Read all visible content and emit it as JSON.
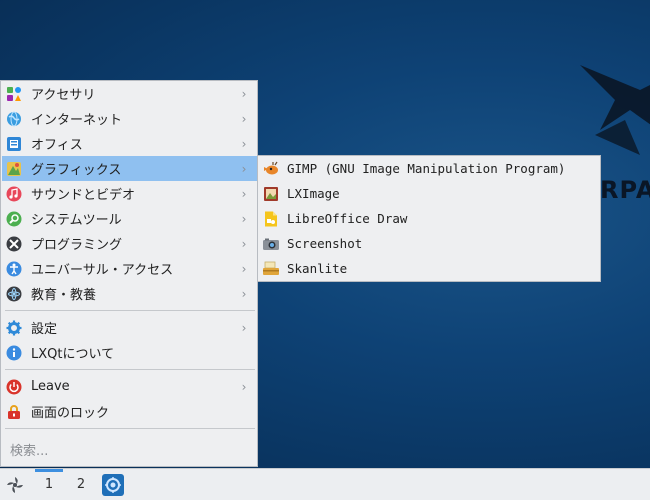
{
  "menu": {
    "items": [
      {
        "label": "アクセサリ",
        "icon": "accessories-icon",
        "has_submenu": true
      },
      {
        "label": "インターネット",
        "icon": "internet-icon",
        "has_submenu": true
      },
      {
        "label": "オフィス",
        "icon": "office-icon",
        "has_submenu": true
      },
      {
        "label": "グラフィックス",
        "icon": "graphics-icon",
        "has_submenu": true,
        "active": true
      },
      {
        "label": "サウンドとビデオ",
        "icon": "sound-video-icon",
        "has_submenu": true
      },
      {
        "label": "システムツール",
        "icon": "system-tools-icon",
        "has_submenu": true
      },
      {
        "label": "プログラミング",
        "icon": "programming-icon",
        "has_submenu": true
      },
      {
        "label": "ユニバーサル・アクセス",
        "icon": "universal-access-icon",
        "has_submenu": true
      },
      {
        "label": "教育・教養",
        "icon": "education-icon",
        "has_submenu": true
      }
    ],
    "settings": {
      "label": "設定",
      "icon": "gear-icon"
    },
    "about": {
      "label": "LXQtについて",
      "icon": "info-icon"
    },
    "leave": {
      "label": "Leave",
      "icon": "power-icon"
    },
    "lock": {
      "label": "画面のロック",
      "icon": "lock-icon"
    },
    "search_placeholder": "検索..."
  },
  "submenu": {
    "items": [
      {
        "label": "GIMP (GNU Image Manipulation Program)",
        "icon": "gimp-icon"
      },
      {
        "label": "LXImage",
        "icon": "image-viewer-icon"
      },
      {
        "label": "LibreOffice Draw",
        "icon": "libreoffice-draw-icon"
      },
      {
        "label": "Screenshot",
        "icon": "camera-icon"
      },
      {
        "label": "Skanlite",
        "icon": "scanner-icon"
      }
    ]
  },
  "taskbar": {
    "desktops": [
      "1",
      "2"
    ],
    "active_desktop": "1"
  },
  "colors": {
    "highlight": "#8fc0f0",
    "menu_bg": "#eeeff1",
    "desktop_bg": "#0e4275",
    "active_desktop_indicator": "#3d8fe0"
  }
}
